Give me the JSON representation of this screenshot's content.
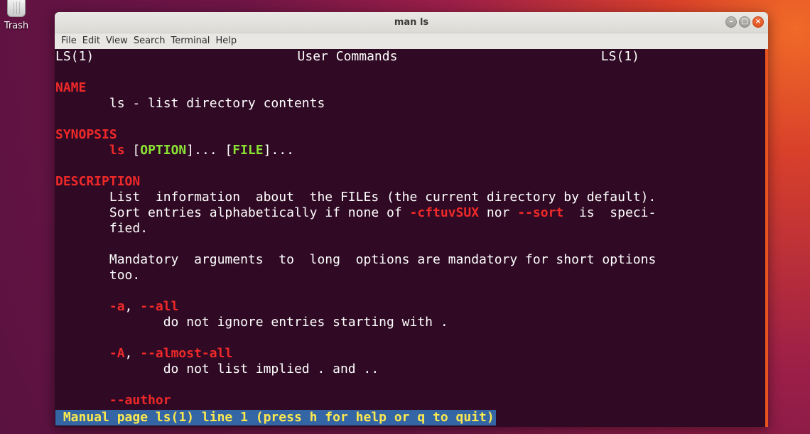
{
  "desktop": {
    "trash_label": "Trash"
  },
  "window": {
    "title": "man ls",
    "menu": [
      "File",
      "Edit",
      "View",
      "Search",
      "Terminal",
      "Help"
    ]
  },
  "man": {
    "header_left": "LS(1)",
    "header_center": "User Commands",
    "header_right": "LS(1)",
    "name_heading": "NAME",
    "name_text": "ls - list directory contents",
    "synopsis_heading": "SYNOPSIS",
    "synopsis": {
      "cmd": "ls",
      "open1": "[",
      "option": "OPTION",
      "mid": "]... [",
      "file": "FILE",
      "close": "]..."
    },
    "description_heading": "DESCRIPTION",
    "desc_line1": "List  information  about  the FILEs (the current directory by default).",
    "desc_line2_a": "Sort entries alphabetically if none of ",
    "desc_line2_opt1": "-cftuvSUX",
    "desc_line2_b": " nor ",
    "desc_line2_opt2": "--sort",
    "desc_line2_c": "  is  speci-",
    "desc_line3": "fied.",
    "mandatory_line1": "Mandatory  arguments  to  long  options are mandatory for short options",
    "mandatory_line2": "too.",
    "opt_a_short": "-a",
    "opt_sep": ", ",
    "opt_a_long": "--all",
    "opt_a_desc": "do not ignore entries starting with .",
    "opt_A_short": "-A",
    "opt_A_long": "--almost-all",
    "opt_A_desc": "do not list implied . and ..",
    "opt_author": "--author",
    "status": " Manual page ls(1) line 1 (press h for help or q to quit)"
  },
  "colors": {
    "terminal_bg": "#300a24",
    "heading_red": "#ef2929",
    "option_green": "#8ae234",
    "status_bg": "#3465a4",
    "status_fg": "#fce94f",
    "accent_orange": "#e95420"
  }
}
